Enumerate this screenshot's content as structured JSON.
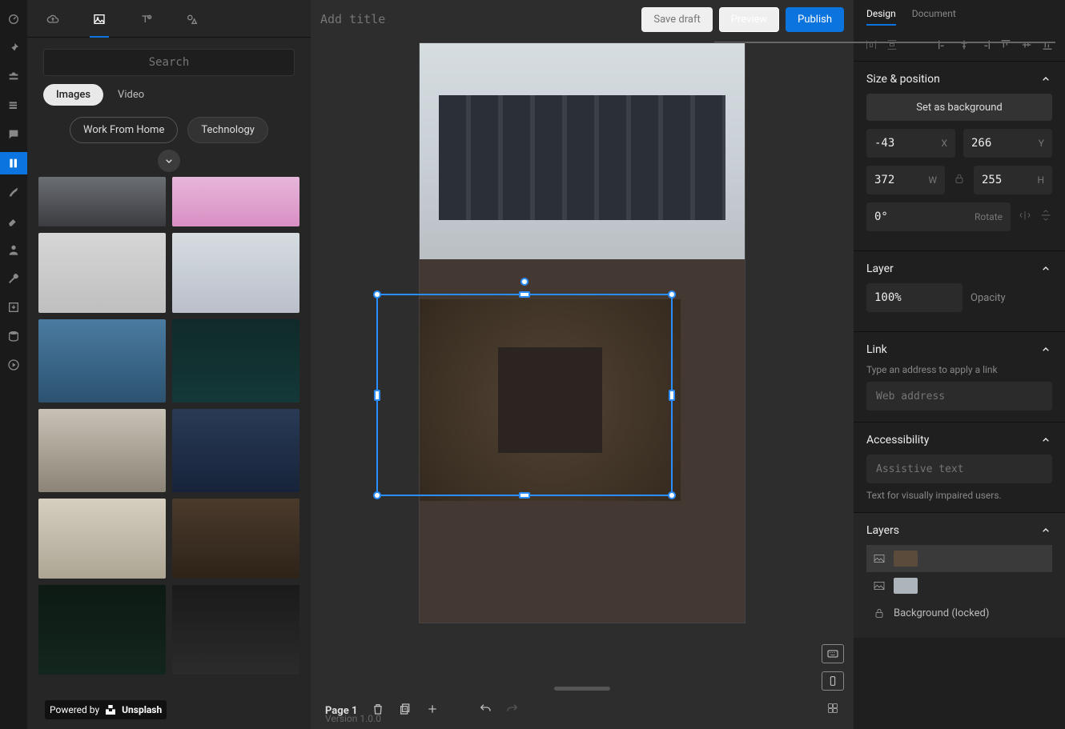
{
  "rail": [
    "dashboard",
    "mail",
    "settings",
    "layers",
    "chat",
    "library",
    "brush",
    "eraser",
    "user",
    "wrench",
    "storage",
    "db",
    "play"
  ],
  "assets": {
    "search_placeholder": "Search",
    "seg_active": "Images",
    "seg_other": "Video",
    "chips": [
      "Work From Home",
      "Technology"
    ],
    "credit_prefix": "Powered by",
    "credit_brand": "Unsplash"
  },
  "header": {
    "title_placeholder": "Add title",
    "save": "Save draft",
    "preview": "Preview",
    "publish": "Publish"
  },
  "page": {
    "label": "Page 1",
    "version": "Version 1.0.0"
  },
  "inspector": {
    "tabs": [
      "Design",
      "Document"
    ],
    "size": {
      "title": "Size & position",
      "bg": "Set as background",
      "x": "-43",
      "y": "266",
      "w": "372",
      "h": "255",
      "rot": "0°",
      "rot_label": "Rotate",
      "xl": "X",
      "yl": "Y",
      "wl": "W",
      "hl": "H"
    },
    "layer": {
      "title": "Layer",
      "opacity": "100%",
      "opl": "Opacity"
    },
    "link": {
      "title": "Link",
      "hint": "Type an address to apply a link",
      "ph": "Web address"
    },
    "a11y": {
      "title": "Accessibility",
      "ph": "Assistive text",
      "hint": "Text for visually impaired users."
    },
    "layers": {
      "title": "Layers",
      "locked": "Background (locked)"
    }
  }
}
